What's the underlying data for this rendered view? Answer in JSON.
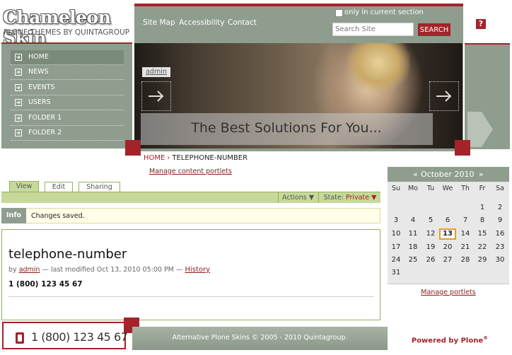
{
  "logo": {
    "title": "Chameleon Skin",
    "subtitle": "PLONE THEMES BY QUINTAGROUP"
  },
  "nav": {
    "items": [
      {
        "label": "HOME"
      },
      {
        "label": "NEWS"
      },
      {
        "label": "EVENTS"
      },
      {
        "label": "USERS"
      },
      {
        "label": "FOLDER 1"
      },
      {
        "label": "FOLDER 2"
      }
    ]
  },
  "header": {
    "links": {
      "sitemap": "Site Map",
      "accessibility": "Accessibility",
      "contact": "Contact"
    },
    "search": {
      "only_current_label": "only in current section",
      "placeholder": "Search Site",
      "button": "SEARCH"
    },
    "help_label": "?"
  },
  "banner": {
    "tag": "admin",
    "caption": "The Best Solutions For You..."
  },
  "breadcrumb": {
    "home": "HOME",
    "separator": "›",
    "current": "TELEPHONE-NUMBER"
  },
  "manage_content_portlets": "Manage content portlets",
  "tabs": {
    "view": "View",
    "edit": "Edit",
    "sharing": "Sharing"
  },
  "actions": {
    "actions_label": "Actions ▼",
    "state_label": "State:",
    "state_value": "Private ▼"
  },
  "info": {
    "label": "Info",
    "message": "Changes saved."
  },
  "document": {
    "title": "telephone-number",
    "by": "by",
    "author": "admin",
    "modified": "— last modified Oct 13, 2010 05:00 PM —",
    "history": "History",
    "body": "1 (800) 123 45 67"
  },
  "phone_box": {
    "number": "1 (800) 123 45 67"
  },
  "footer": {
    "text": "Alternative Plone Skins © 2005 - 2010 Quintagroup.",
    "powered": "Powered by Plone"
  },
  "calendar": {
    "prev": "«",
    "month": "October 2010",
    "next": "»",
    "weekdays": [
      "Su",
      "Mo",
      "Tu",
      "We",
      "Th",
      "Fr",
      "Sa"
    ],
    "days": [
      "1",
      "2",
      "3",
      "4",
      "5",
      "6",
      "7",
      "8",
      "9",
      "10",
      "11",
      "12",
      "13",
      "14",
      "15",
      "16",
      "17",
      "18",
      "19",
      "20",
      "21",
      "22",
      "23",
      "24",
      "25",
      "26",
      "27",
      "28",
      "29",
      "30",
      "31"
    ],
    "today": "13",
    "manage_portlets": "Manage portlets"
  },
  "colors": {
    "accent": "#a4232a",
    "sage": "#8f9d8e",
    "tab_green": "#c6d99a",
    "border_green": "#8fb35a"
  }
}
